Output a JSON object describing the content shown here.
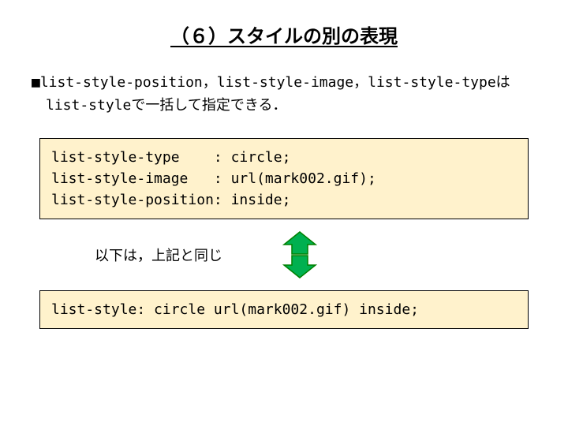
{
  "title": "（６）スタイルの別の表現",
  "description": "■list-style-position，list-style-image，list-style-typeは\n　list-styleで一括して指定できる．",
  "code_box_1": "list-style-type    : circle;\nlist-style-image   : url(mark002.gif);\nlist-style-position: inside;",
  "note": "以下は，上記と同じ",
  "code_box_2": "list-style: circle url(mark002.gif) inside;",
  "colors": {
    "code_bg": "#fff2cc",
    "arrow_fill": "#00b050",
    "arrow_stroke": "#008000"
  }
}
